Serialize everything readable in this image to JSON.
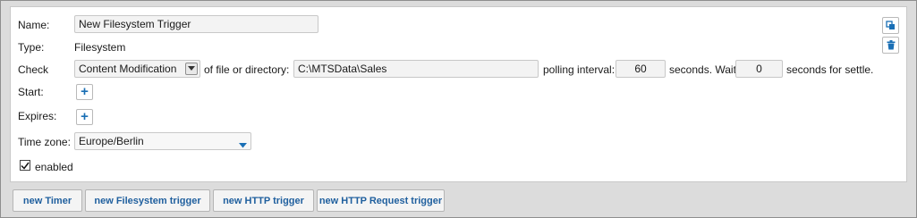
{
  "form": {
    "name_label": "Name:",
    "name_value": "New Filesystem Trigger",
    "type_label": "Type:",
    "type_value": "Filesystem",
    "check_label": "Check",
    "check_mode": "Content Modification",
    "of_file_text": "of file or directory:",
    "path_value": "C:\\MTSData\\Sales",
    "polling_label": "polling interval:",
    "polling_value": "60",
    "seconds_wait_text": "seconds. Wait",
    "settle_value": "0",
    "settle_text": "seconds for settle.",
    "start_label": "Start:",
    "expires_label": "Expires:",
    "timezone_label": "Time zone:",
    "timezone_value": "Europe/Berlin",
    "enabled_label": "enabled",
    "enabled_checked": true
  },
  "buttons": {
    "new_timer": "new Timer",
    "new_filesystem": "new Filesystem trigger",
    "new_http": "new HTTP trigger",
    "new_http_request": "new HTTP Request trigger"
  },
  "icons": {
    "copy": "copy-icon",
    "delete": "trash-icon",
    "add": "plus-icon",
    "dropdown": "chevron-down-icon",
    "checkbox": "checkmark-icon"
  },
  "colors": {
    "accent": "#1a6fb5",
    "panel_bg": "#ffffff",
    "frame_bg": "#dcdcdc",
    "field_bg": "#f3f3f3"
  }
}
